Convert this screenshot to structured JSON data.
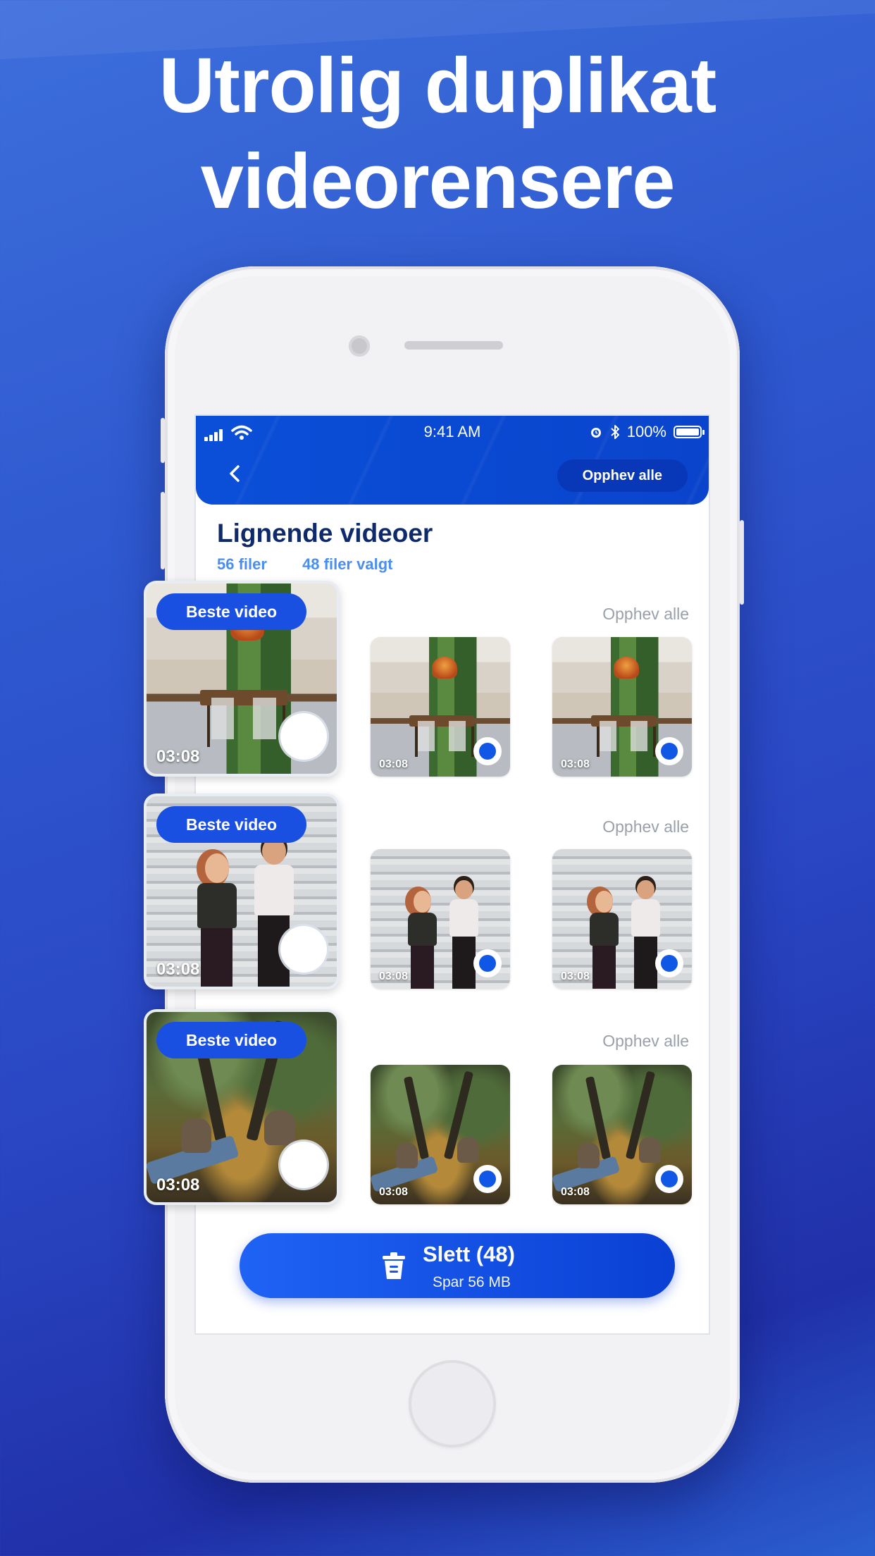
{
  "headline": {
    "line1": "Utrolig duplikat",
    "line2": "videorensere"
  },
  "status_bar": {
    "time": "9:41 AM",
    "battery": "100%"
  },
  "nav": {
    "unselect_all": "Opphev alle"
  },
  "page": {
    "title": "Lignende videoer",
    "files": "56 filer",
    "selected": "48 filer valgt"
  },
  "groups": [
    {
      "unselect": "Opphev alle",
      "best_label": "Beste video",
      "best_duration": "03:08",
      "durations": [
        "03:08",
        "03:08"
      ]
    },
    {
      "unselect": "Opphev alle",
      "best_label": "Beste video",
      "best_duration": "03:08",
      "durations": [
        "03:08",
        "03:08"
      ]
    },
    {
      "unselect": "Opphev alle",
      "best_label": "Beste video",
      "best_duration": "03:08",
      "durations": [
        "03:08",
        "03:08"
      ]
    }
  ],
  "delete": {
    "label": "Slett (48)",
    "sub": "Spar 56 MB"
  },
  "icons": [
    "signal-icon",
    "wifi-icon",
    "alarm-icon",
    "bluetooth-icon",
    "battery-icon",
    "back-chevron-icon",
    "trash-icon",
    "check-icon"
  ],
  "colors": {
    "brand": "#0b4fd8",
    "title": "#0f2a6b",
    "accent_text": "#4a8ef0",
    "muted": "#9aa0aa"
  }
}
